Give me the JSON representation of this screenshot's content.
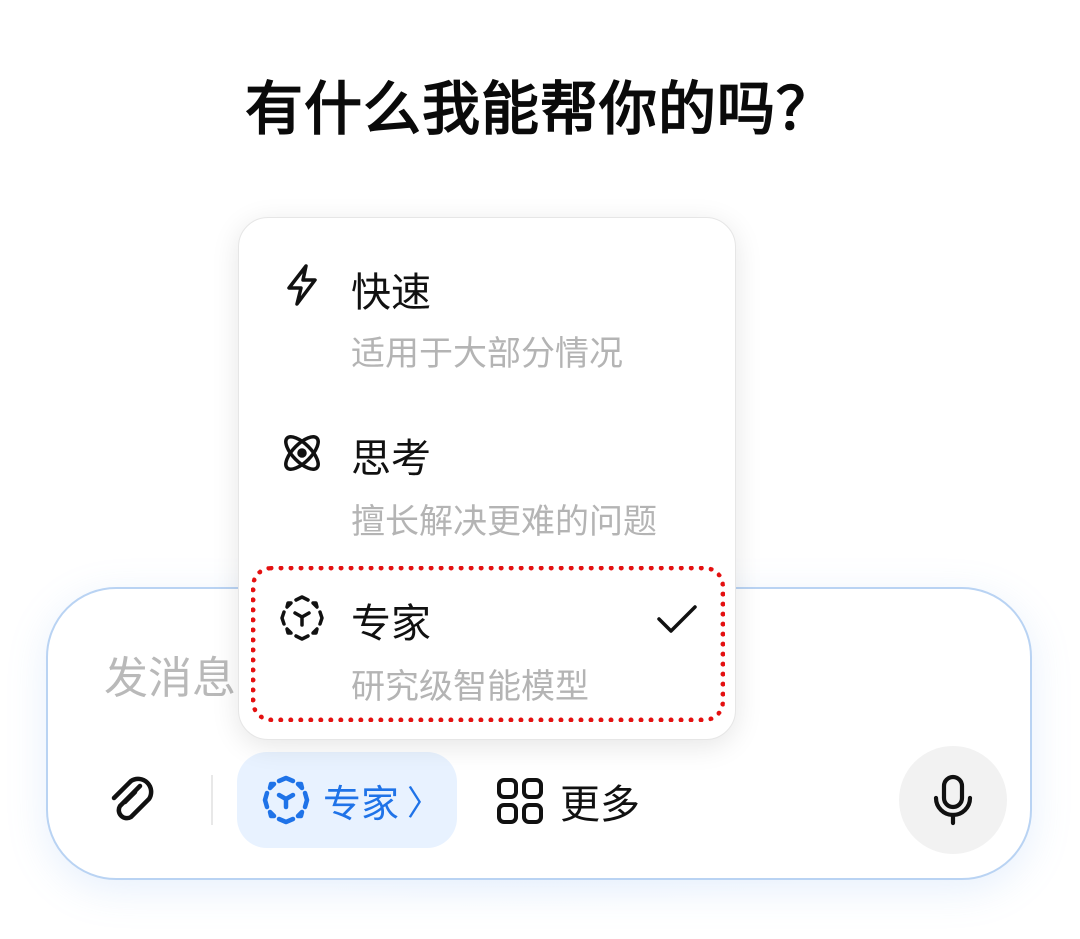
{
  "header": {
    "title": "有什么我能帮你的吗？"
  },
  "composer": {
    "placeholder": "发消息",
    "mode_chip": {
      "label": "专家",
      "chevron": "〉",
      "icon": "expert-cube-icon"
    },
    "more": {
      "label": "更多",
      "icon": "grid-icon"
    },
    "attach_icon": "paperclip-icon",
    "mic_icon": "microphone-icon"
  },
  "mode_menu": {
    "items": [
      {
        "name": "快速",
        "desc": "适用于大部分情况",
        "icon": "lightning-icon",
        "selected": false
      },
      {
        "name": "思考",
        "desc": "擅长解决更难的问题",
        "icon": "atom-icon",
        "selected": false
      },
      {
        "name": "专家",
        "desc": "研究级智能模型",
        "icon": "expert-cube-icon",
        "selected": true
      }
    ]
  },
  "colors": {
    "accent": "#1f73e8",
    "highlight": "#e41010",
    "chip_bg": "#e8f2ff"
  }
}
